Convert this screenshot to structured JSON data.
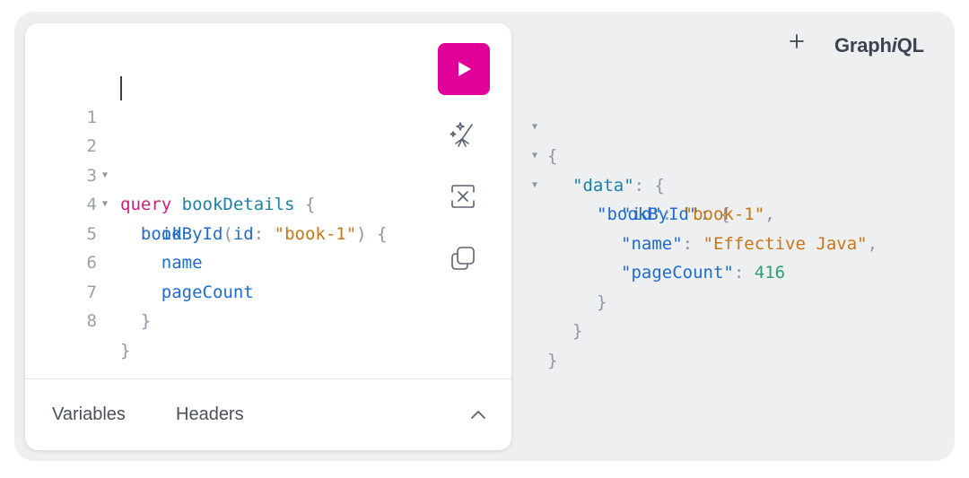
{
  "app": {
    "logo_prefix": "Graph",
    "logo_italic": "i",
    "logo_suffix": "QL",
    "add_tab_icon": "plus-icon"
  },
  "editor": {
    "line_numbers": [
      "1",
      "2",
      "3",
      "4",
      "5",
      "6",
      "7",
      "8"
    ],
    "query": {
      "keyword": "query",
      "operation_name": "bookDetails",
      "open_brace": "{",
      "field_bookById": "bookById",
      "paren_open": "(",
      "arg_name": "id",
      "colon": ":",
      "arg_value": "\"book-1\"",
      "paren_close": ")",
      "inner_open_brace": "{",
      "fields": [
        "id",
        "name",
        "pageCount"
      ],
      "inner_close_brace": "}",
      "close_brace": "}"
    },
    "toolbar": {
      "run_icon": "play-icon",
      "prettify_icon": "magic-wand-icon",
      "merge_icon": "merge-fragments-icon",
      "copy_icon": "copy-icon"
    },
    "bottom_tabs": [
      "Variables",
      "Headers"
    ],
    "toggle_icon": "chevron-up-icon"
  },
  "result": {
    "open_brace": "{",
    "data_key": "\"data\"",
    "colon": ":",
    "bookById_key": "\"bookById\"",
    "entries": [
      {
        "key": "\"id\"",
        "value": "\"book-1\"",
        "type": "string",
        "comma": ","
      },
      {
        "key": "\"name\"",
        "value": "\"Effective Java\"",
        "type": "string",
        "comma": ","
      },
      {
        "key": "\"pageCount\"",
        "value": "416",
        "type": "number",
        "comma": ""
      }
    ],
    "close_brace": "}"
  }
}
